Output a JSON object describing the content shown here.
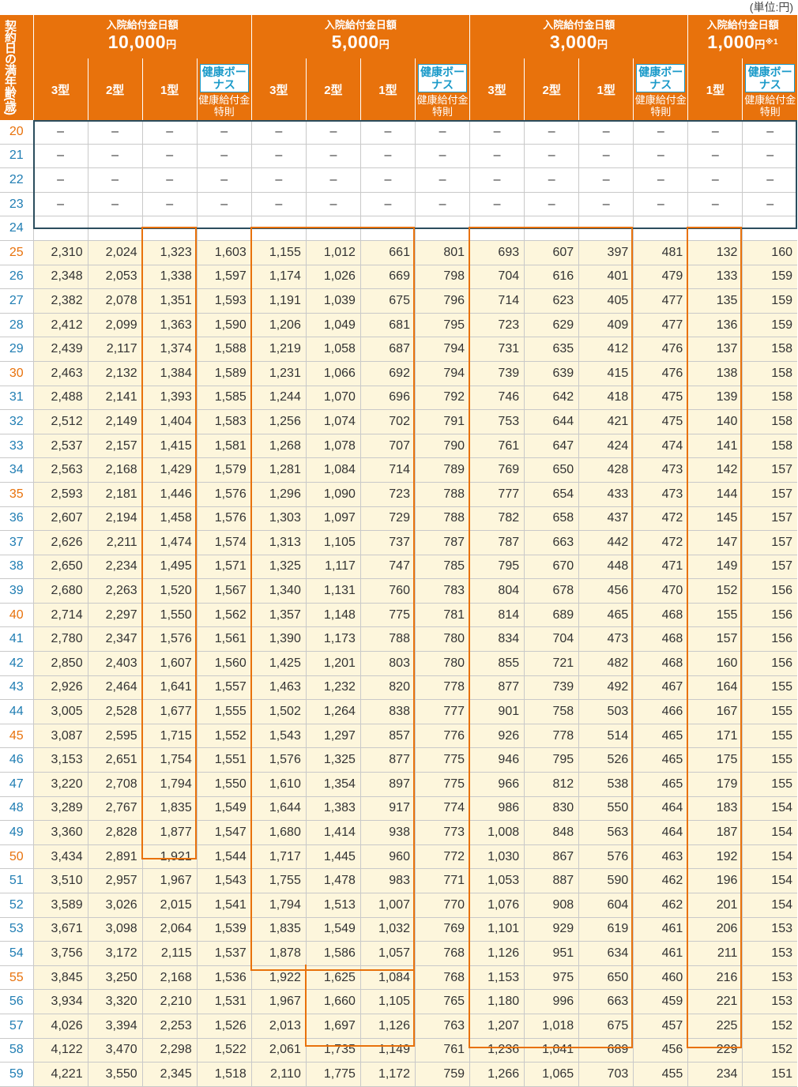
{
  "unit_note": "(単位:円)",
  "corner_header": "契約日の満年齢(歳)",
  "groups": [
    {
      "title": "入院給付金日額",
      "amount": "10,000",
      "yen": "円",
      "note": ""
    },
    {
      "title": "入院給付金日額",
      "amount": "5,000",
      "yen": "円",
      "note": ""
    },
    {
      "title": "入院給付金日額",
      "amount": "3,000",
      "yen": "円",
      "note": ""
    },
    {
      "title": "入院給付金日額",
      "amount": "1,000",
      "yen": "円",
      "note": "※1"
    }
  ],
  "types": {
    "t3": "3型",
    "t2": "2型",
    "t1": "1型"
  },
  "bonus": {
    "badge": "健康ボーナス",
    "sub": "健康給付金特則"
  },
  "dash": "–",
  "rows": [
    {
      "age": "20",
      "v": []
    },
    {
      "age": "21",
      "v": []
    },
    {
      "age": "22",
      "v": []
    },
    {
      "age": "23",
      "v": []
    },
    {
      "age": "24",
      "v": []
    },
    {
      "age": "25",
      "v": [
        "2,310",
        "2,024",
        "1,323",
        "1,603",
        "1,155",
        "1,012",
        "661",
        "801",
        "693",
        "607",
        "397",
        "481",
        "132",
        "160"
      ]
    },
    {
      "age": "26",
      "v": [
        "2,348",
        "2,053",
        "1,338",
        "1,597",
        "1,174",
        "1,026",
        "669",
        "798",
        "704",
        "616",
        "401",
        "479",
        "133",
        "159"
      ]
    },
    {
      "age": "27",
      "v": [
        "2,382",
        "2,078",
        "1,351",
        "1,593",
        "1,191",
        "1,039",
        "675",
        "796",
        "714",
        "623",
        "405",
        "477",
        "135",
        "159"
      ]
    },
    {
      "age": "28",
      "v": [
        "2,412",
        "2,099",
        "1,363",
        "1,590",
        "1,206",
        "1,049",
        "681",
        "795",
        "723",
        "629",
        "409",
        "477",
        "136",
        "159"
      ]
    },
    {
      "age": "29",
      "v": [
        "2,439",
        "2,117",
        "1,374",
        "1,588",
        "1,219",
        "1,058",
        "687",
        "794",
        "731",
        "635",
        "412",
        "476",
        "137",
        "158"
      ]
    },
    {
      "age": "30",
      "v": [
        "2,463",
        "2,132",
        "1,384",
        "1,589",
        "1,231",
        "1,066",
        "692",
        "794",
        "739",
        "639",
        "415",
        "476",
        "138",
        "158"
      ]
    },
    {
      "age": "31",
      "v": [
        "2,488",
        "2,141",
        "1,393",
        "1,585",
        "1,244",
        "1,070",
        "696",
        "792",
        "746",
        "642",
        "418",
        "475",
        "139",
        "158"
      ]
    },
    {
      "age": "32",
      "v": [
        "2,512",
        "2,149",
        "1,404",
        "1,583",
        "1,256",
        "1,074",
        "702",
        "791",
        "753",
        "644",
        "421",
        "475",
        "140",
        "158"
      ]
    },
    {
      "age": "33",
      "v": [
        "2,537",
        "2,157",
        "1,415",
        "1,581",
        "1,268",
        "1,078",
        "707",
        "790",
        "761",
        "647",
        "424",
        "474",
        "141",
        "158"
      ]
    },
    {
      "age": "34",
      "v": [
        "2,563",
        "2,168",
        "1,429",
        "1,579",
        "1,281",
        "1,084",
        "714",
        "789",
        "769",
        "650",
        "428",
        "473",
        "142",
        "157"
      ]
    },
    {
      "age": "35",
      "v": [
        "2,593",
        "2,181",
        "1,446",
        "1,576",
        "1,296",
        "1,090",
        "723",
        "788",
        "777",
        "654",
        "433",
        "473",
        "144",
        "157"
      ]
    },
    {
      "age": "36",
      "v": [
        "2,607",
        "2,194",
        "1,458",
        "1,576",
        "1,303",
        "1,097",
        "729",
        "788",
        "782",
        "658",
        "437",
        "472",
        "145",
        "157"
      ]
    },
    {
      "age": "37",
      "v": [
        "2,626",
        "2,211",
        "1,474",
        "1,574",
        "1,313",
        "1,105",
        "737",
        "787",
        "787",
        "663",
        "442",
        "472",
        "147",
        "157"
      ]
    },
    {
      "age": "38",
      "v": [
        "2,650",
        "2,234",
        "1,495",
        "1,571",
        "1,325",
        "1,117",
        "747",
        "785",
        "795",
        "670",
        "448",
        "471",
        "149",
        "157"
      ]
    },
    {
      "age": "39",
      "v": [
        "2,680",
        "2,263",
        "1,520",
        "1,567",
        "1,340",
        "1,131",
        "760",
        "783",
        "804",
        "678",
        "456",
        "470",
        "152",
        "156"
      ]
    },
    {
      "age": "40",
      "v": [
        "2,714",
        "2,297",
        "1,550",
        "1,562",
        "1,357",
        "1,148",
        "775",
        "781",
        "814",
        "689",
        "465",
        "468",
        "155",
        "156"
      ]
    },
    {
      "age": "41",
      "v": [
        "2,780",
        "2,347",
        "1,576",
        "1,561",
        "1,390",
        "1,173",
        "788",
        "780",
        "834",
        "704",
        "473",
        "468",
        "157",
        "156"
      ]
    },
    {
      "age": "42",
      "v": [
        "2,850",
        "2,403",
        "1,607",
        "1,560",
        "1,425",
        "1,201",
        "803",
        "780",
        "855",
        "721",
        "482",
        "468",
        "160",
        "156"
      ]
    },
    {
      "age": "43",
      "v": [
        "2,926",
        "2,464",
        "1,641",
        "1,557",
        "1,463",
        "1,232",
        "820",
        "778",
        "877",
        "739",
        "492",
        "467",
        "164",
        "155"
      ]
    },
    {
      "age": "44",
      "v": [
        "3,005",
        "2,528",
        "1,677",
        "1,555",
        "1,502",
        "1,264",
        "838",
        "777",
        "901",
        "758",
        "503",
        "466",
        "167",
        "155"
      ]
    },
    {
      "age": "45",
      "v": [
        "3,087",
        "2,595",
        "1,715",
        "1,552",
        "1,543",
        "1,297",
        "857",
        "776",
        "926",
        "778",
        "514",
        "465",
        "171",
        "155"
      ]
    },
    {
      "age": "46",
      "v": [
        "3,153",
        "2,651",
        "1,754",
        "1,551",
        "1,576",
        "1,325",
        "877",
        "775",
        "946",
        "795",
        "526",
        "465",
        "175",
        "155"
      ]
    },
    {
      "age": "47",
      "v": [
        "3,220",
        "2,708",
        "1,794",
        "1,550",
        "1,610",
        "1,354",
        "897",
        "775",
        "966",
        "812",
        "538",
        "465",
        "179",
        "155"
      ]
    },
    {
      "age": "48",
      "v": [
        "3,289",
        "2,767",
        "1,835",
        "1,549",
        "1,644",
        "1,383",
        "917",
        "774",
        "986",
        "830",
        "550",
        "464",
        "183",
        "154"
      ]
    },
    {
      "age": "49",
      "v": [
        "3,360",
        "2,828",
        "1,877",
        "1,547",
        "1,680",
        "1,414",
        "938",
        "773",
        "1,008",
        "848",
        "563",
        "464",
        "187",
        "154"
      ]
    },
    {
      "age": "50",
      "v": [
        "3,434",
        "2,891",
        "1,921",
        "1,544",
        "1,717",
        "1,445",
        "960",
        "772",
        "1,030",
        "867",
        "576",
        "463",
        "192",
        "154"
      ]
    },
    {
      "age": "51",
      "v": [
        "3,510",
        "2,957",
        "1,967",
        "1,543",
        "1,755",
        "1,478",
        "983",
        "771",
        "1,053",
        "887",
        "590",
        "462",
        "196",
        "154"
      ]
    },
    {
      "age": "52",
      "v": [
        "3,589",
        "3,026",
        "2,015",
        "1,541",
        "1,794",
        "1,513",
        "1,007",
        "770",
        "1,076",
        "908",
        "604",
        "462",
        "201",
        "154"
      ]
    },
    {
      "age": "53",
      "v": [
        "3,671",
        "3,098",
        "2,064",
        "1,539",
        "1,835",
        "1,549",
        "1,032",
        "769",
        "1,101",
        "929",
        "619",
        "461",
        "206",
        "153"
      ]
    },
    {
      "age": "54",
      "v": [
        "3,756",
        "3,172",
        "2,115",
        "1,537",
        "1,878",
        "1,586",
        "1,057",
        "768",
        "1,126",
        "951",
        "634",
        "461",
        "211",
        "153"
      ]
    },
    {
      "age": "55",
      "v": [
        "3,845",
        "3,250",
        "2,168",
        "1,536",
        "1,922",
        "1,625",
        "1,084",
        "768",
        "1,153",
        "975",
        "650",
        "460",
        "216",
        "153"
      ]
    },
    {
      "age": "56",
      "v": [
        "3,934",
        "3,320",
        "2,210",
        "1,531",
        "1,967",
        "1,660",
        "1,105",
        "765",
        "1,180",
        "996",
        "663",
        "459",
        "221",
        "153"
      ]
    },
    {
      "age": "57",
      "v": [
        "4,026",
        "3,394",
        "2,253",
        "1,526",
        "2,013",
        "1,697",
        "1,126",
        "763",
        "1,207",
        "1,018",
        "675",
        "457",
        "225",
        "152"
      ]
    },
    {
      "age": "58",
      "v": [
        "4,122",
        "3,470",
        "2,298",
        "1,522",
        "2,061",
        "1,735",
        "1,149",
        "761",
        "1,236",
        "1,041",
        "689",
        "456",
        "229",
        "152"
      ]
    },
    {
      "age": "59",
      "v": [
        "4,221",
        "3,550",
        "2,345",
        "1,518",
        "2,110",
        "1,775",
        "1,172",
        "759",
        "1,266",
        "1,065",
        "703",
        "455",
        "234",
        "151"
      ]
    }
  ]
}
